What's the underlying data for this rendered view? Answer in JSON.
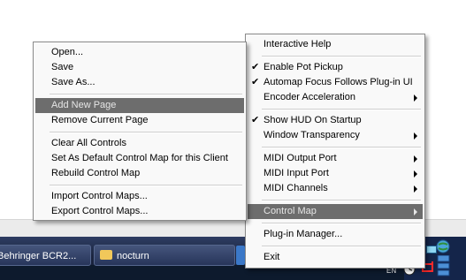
{
  "left_menu": {
    "items": [
      {
        "label": "Open..."
      },
      {
        "label": "Save"
      },
      {
        "label": "Save As..."
      },
      {
        "label": "Add New Page"
      },
      {
        "label": "Remove Current Page"
      },
      {
        "label": "Clear All Controls"
      },
      {
        "label": "Set As Default Control Map for this Client"
      },
      {
        "label": "Rebuild Control Map"
      },
      {
        "label": "Import Control Maps..."
      },
      {
        "label": "Export Control Maps..."
      }
    ]
  },
  "right_menu": {
    "items": [
      {
        "label": "Interactive Help"
      },
      {
        "label": "Enable Pot Pickup"
      },
      {
        "label": "Automap Focus Follows Plug-in UI"
      },
      {
        "label": "Encoder Acceleration"
      },
      {
        "label": "Show HUD On Startup"
      },
      {
        "label": "Window Transparency"
      },
      {
        "label": "MIDI Output Port"
      },
      {
        "label": "MIDI Input Port"
      },
      {
        "label": "MIDI Channels"
      },
      {
        "label": "Control Map"
      },
      {
        "label": "Plug-in Manager..."
      },
      {
        "label": "Exit"
      }
    ],
    "check_glyph": "✔"
  },
  "taskbar": {
    "buttons": [
      {
        "label": "Behringer BCR2..."
      },
      {
        "label": "nocturn"
      }
    ],
    "tray_language": "EN"
  },
  "colors": {
    "highlight": "#6d6d6d",
    "taskbar": "#1b2540"
  }
}
